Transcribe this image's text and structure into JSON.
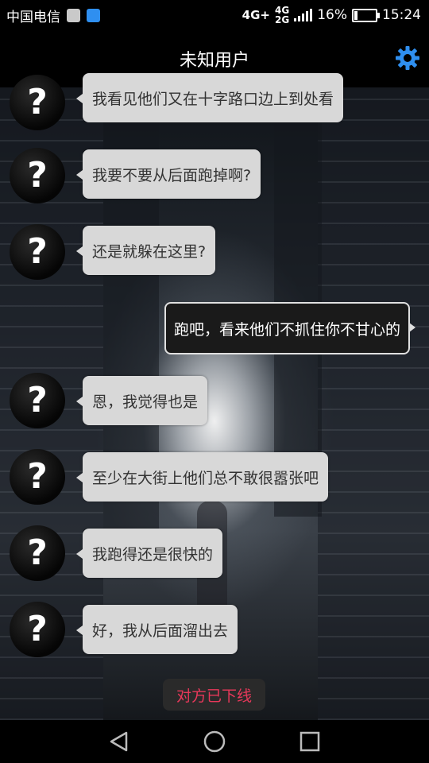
{
  "status_bar": {
    "carrier": "中国电信",
    "network": "4G+",
    "network_small_top": "4G",
    "network_small_bottom": "2G",
    "battery_percent": "16%",
    "battery_level": 0.16,
    "time": "15:24"
  },
  "header": {
    "title": "未知用户",
    "settings_icon": "gear-icon",
    "accent": "#2f8ff0"
  },
  "messages": [
    {
      "from": "them",
      "text": "我看见他们又在十字路口边上到处看"
    },
    {
      "from": "them",
      "text": "我要不要从后面跑掉啊?"
    },
    {
      "from": "them",
      "text": "还是就躲在这里?"
    },
    {
      "from": "me",
      "text": "跑吧，看来他们不抓住你不甘心的"
    },
    {
      "from": "them",
      "text": "恩，我觉得也是"
    },
    {
      "from": "them",
      "text": "至少在大街上他们总不敢很嚣张吧"
    },
    {
      "from": "them",
      "text": "我跑得还是很快的"
    },
    {
      "from": "them",
      "text": "好，我从后面溜出去"
    }
  ],
  "avatar_glyph": "?",
  "status_notice": {
    "text": "对方已下线",
    "color": "#e8385a"
  },
  "nav": {
    "back_icon": "back-triangle-icon",
    "home_icon": "home-circle-icon",
    "recents_icon": "recents-square-icon"
  }
}
